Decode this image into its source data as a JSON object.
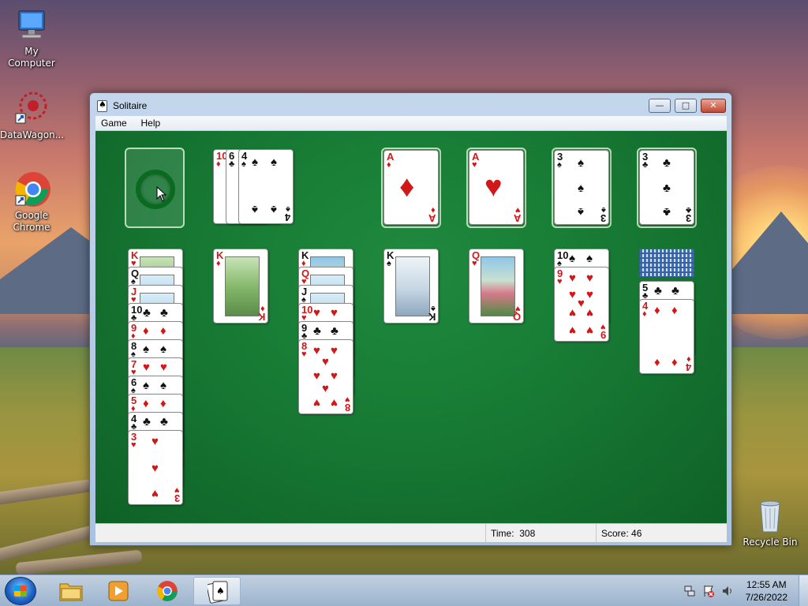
{
  "desktop": {
    "icons": [
      {
        "label": "My Computer"
      },
      {
        "label": "DataWagon..."
      },
      {
        "label": "Google Chrome"
      },
      {
        "label": "Recycle Bin"
      }
    ]
  },
  "window": {
    "title": "Solitaire",
    "menu": [
      "Game",
      "Help"
    ],
    "status": {
      "time_label": "Time:",
      "time_value": "308",
      "score_label": "Score:",
      "score_value": "46"
    }
  },
  "game": {
    "waste": [
      {
        "rank": "10",
        "suit": "♦",
        "color": "red"
      },
      {
        "rank": "6",
        "suit": "♣",
        "color": "blk"
      },
      {
        "rank": "4",
        "suit": "♠",
        "color": "blk"
      }
    ],
    "foundations": [
      {
        "rank": "A",
        "suit": "♦",
        "color": "red"
      },
      {
        "rank": "A",
        "suit": "♥",
        "color": "red"
      },
      {
        "rank": "3",
        "suit": "♠",
        "color": "blk"
      },
      {
        "rank": "3",
        "suit": "♣",
        "color": "blk"
      }
    ],
    "tableau": [
      [
        {
          "rank": "K",
          "suit": "♥",
          "color": "red"
        },
        {
          "rank": "Q",
          "suit": "♠",
          "color": "blk"
        },
        {
          "rank": "J",
          "suit": "♥",
          "color": "red"
        },
        {
          "rank": "10",
          "suit": "♣",
          "color": "blk"
        },
        {
          "rank": "9",
          "suit": "♦",
          "color": "red"
        },
        {
          "rank": "8",
          "suit": "♠",
          "color": "blk"
        },
        {
          "rank": "7",
          "suit": "♥",
          "color": "red"
        },
        {
          "rank": "6",
          "suit": "♠",
          "color": "blk"
        },
        {
          "rank": "5",
          "suit": "♦",
          "color": "red"
        },
        {
          "rank": "4",
          "suit": "♣",
          "color": "blk"
        },
        {
          "rank": "3",
          "suit": "♥",
          "color": "red"
        }
      ],
      [
        {
          "rank": "K",
          "suit": "♦",
          "color": "red"
        }
      ],
      [
        {
          "rank": "K",
          "suit": "♦",
          "color": "red"
        },
        {
          "rank": "Q",
          "suit": "♥",
          "color": "red"
        },
        {
          "rank": "J",
          "suit": "♠",
          "color": "blk"
        },
        {
          "rank": "10",
          "suit": "♥",
          "color": "red"
        },
        {
          "rank": "9",
          "suit": "♣",
          "color": "blk"
        },
        {
          "rank": "8",
          "suit": "♥",
          "color": "red"
        }
      ],
      [
        {
          "rank": "K",
          "suit": "♠",
          "color": "blk"
        }
      ],
      [
        {
          "rank": "Q",
          "suit": "♥",
          "color": "red"
        }
      ],
      [
        {
          "rank": "10",
          "suit": "♠",
          "color": "blk"
        },
        {
          "rank": "9",
          "suit": "♥",
          "color": "red"
        }
      ],
      [
        {
          "rank": "5",
          "suit": "♣",
          "color": "blk"
        },
        {
          "rank": "4",
          "suit": "♦",
          "color": "red"
        }
      ]
    ]
  },
  "taskbar": {
    "clock_time": "12:55 AM",
    "clock_date": "7/26/2022",
    "apps": [
      "folder-icon",
      "media-player-icon",
      "chrome-icon",
      "solitaire-icon"
    ]
  }
}
